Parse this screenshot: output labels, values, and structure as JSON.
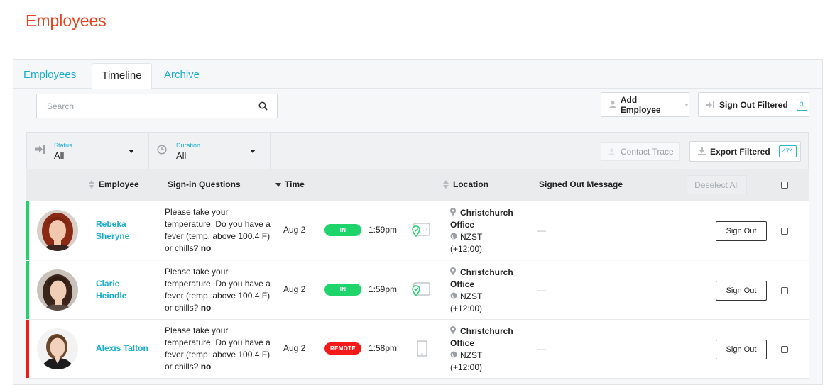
{
  "page": {
    "title": "Employees"
  },
  "tabs": [
    {
      "label": "Employees",
      "active": false
    },
    {
      "label": "Timeline",
      "active": true
    },
    {
      "label": "Archive",
      "active": false
    }
  ],
  "search": {
    "placeholder": "Search",
    "value": ""
  },
  "toolbar": {
    "add_employee_label": "Add Employee",
    "sign_out_filtered_label": "Sign Out Filtered",
    "sign_out_filtered_count": "3"
  },
  "filters": {
    "status": {
      "label": "Status",
      "value": "All"
    },
    "duration": {
      "label": "Duration",
      "value": "All"
    },
    "contact_trace_label": "Contact Trace",
    "export_filtered_label": "Export Filtered",
    "export_filtered_count": "474"
  },
  "table": {
    "headers": {
      "employee": "Employee",
      "questions": "Sign-in Questions",
      "time": "Time",
      "location": "Location",
      "message": "Signed Out Message",
      "deselect_all": "Deselect All"
    },
    "rows": [
      {
        "name_line1": "Rebeka",
        "name_line2": "Sheryne",
        "question": "Please take your temperature. Do you have a fever (temp. above 100.4 F) or chills?",
        "answer": "no",
        "date": "Aug 2",
        "status": "IN",
        "status_color": "#1ed46b",
        "bar_color": "#1ed46b",
        "time": "1:59pm",
        "device": "tablet-check-icon",
        "location_name": "Christchurch",
        "location_sub": "Office",
        "timezone": "NZST",
        "timezone_offset": "(+12:00)",
        "message": "—",
        "action": "Sign Out"
      },
      {
        "name_line1": "Clarie",
        "name_line2": "Heindle",
        "question": "Please take your temperature. Do you have a fever (temp. above 100.4 F) or chills?",
        "answer": "no",
        "date": "Aug 2",
        "status": "IN",
        "status_color": "#1ed46b",
        "bar_color": "#1ed46b",
        "time": "1:59pm",
        "device": "tablet-check-icon",
        "location_name": "Christchurch",
        "location_sub": "Office",
        "timezone": "NZST",
        "timezone_offset": "(+12:00)",
        "message": "—",
        "action": "Sign Out"
      },
      {
        "name_line1": "Alexis Talton",
        "name_line2": "",
        "question": "Please take your temperature. Do you have a fever (temp. above 100.4 F) or chills?",
        "answer": "no",
        "date": "Aug 2",
        "status": "REMOTE",
        "status_color": "#f41a1a",
        "bar_color": "#f41a1a",
        "time": "1:58pm",
        "device": "phone-icon",
        "location_name": "Christchurch",
        "location_sub": "Office",
        "timezone": "NZST",
        "timezone_offset": "(+12:00)",
        "message": "—",
        "action": "Sign Out"
      }
    ]
  }
}
